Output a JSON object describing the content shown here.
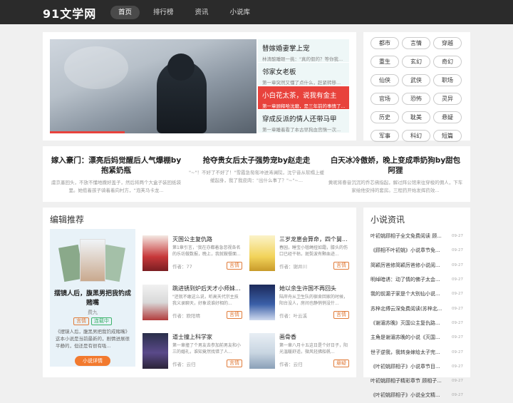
{
  "header": {
    "logo": "91文学网",
    "nav": [
      "首页",
      "排行榜",
      "资讯",
      "小说库"
    ]
  },
  "banner": {
    "items": [
      {
        "title": "替嫁婚妻掌上宠",
        "desc": "林清酿睡眼一挑：\"真的假的？等你我..."
      },
      {
        "title": "邻家女老板",
        "desc": "第一章突然又懂了点什么，赶紧转移..."
      },
      {
        "title": "小白花太茶，说我有金主",
        "desc": "第一章顾释哈沈磨，是三年前的事情了..."
      },
      {
        "title": "穿成反派的情人还带马甲",
        "desc": "第一章睡着看了本古早狗血宫惰一次..."
      }
    ]
  },
  "categories": [
    "都市",
    "言情",
    "穿越",
    "重生",
    "玄幻",
    "奇幻",
    "仙侠",
    "武侠",
    "职场",
    "官场",
    "恐怖",
    "灵异",
    "历史",
    "耽美",
    "悬疑",
    "军事",
    "科幻",
    "短篇"
  ],
  "featured": [
    {
      "title": "嫁入豪门：漂亮后妈觉醒后人气爆棚by抱紧奶瓶",
      "desc": "虞京墨回头，不放不懂地撒好盖子，然后将两个大盒子装回纸袋里。她揽着孩子骑着着向村方，“泡芙马卡龙..."
    },
    {
      "title": "抢夺贵女后太子强势宠by赵走走",
      "desc": "\"~\"！不好了不好了！\"雪霞急匆匆冲进浠澜院，沈宁音从软榻上缓缓起身，我了我皮肉：\"出什么事了？\"~\"~..."
    },
    {
      "title": "白天冰冷傲娇，晚上变成乖奶狗by甜包阿狸",
      "desc": "黄昵将眷音沉沉的乔芯佛指起，解过阵公馆来往穿梭的佣人，下车家绘他安排的套房。三程药开始发挥药效..."
    }
  ],
  "editor": {
    "title": "编辑推荐",
    "main": {
      "title": "摆镜人后，腹黑男把我钓成赌嘴",
      "author": "费九",
      "tags": [
        "言情",
        "连载中"
      ],
      "desc": "《摆镜人后，腹黑男把我钓成赌嘴》这本小说是当前最新的，剧情进展很平静的，但还是有很有吸...",
      "button": "小说详情"
    },
    "books": [
      {
        "title": "灭国公主复仇路",
        "desc": "第1章引言，'我在亦都着急忽视各名的乐坊做数报，晚上，我就鞍餐面...",
        "author": "作者：77",
        "tag": "言情"
      },
      {
        "title": "三岁龙崽会算命，四个舅...",
        "desc": "春园，睡宝小毯绳扭如霜，膝头的伤口已经干枯，斑鬓波有颗血迹...",
        "author": "作者：谢井川",
        "tag": "言情"
      },
      {
        "title": "跳进锈到炉后天才小师妹...",
        "desc": "\"还就不敢这么说，听高天代宗主技我义录聊天，好象说谁好相的...",
        "author": "作者：欧阳晴",
        "tag": "言情"
      },
      {
        "title": "她以余生许国不再回头",
        "desc": "陆岸舟从卫生队的宿舍回家的时候，阳台没人，房间也静悄悄没什...",
        "author": "作者：叶云溪",
        "tag": "言情"
      },
      {
        "title": "道士撞上科学家",
        "desc": "第一章撞了个男友去参加前男友和小三的婚礼，谁知竟然找错了人...",
        "author": "作者：云归",
        "tag": "言情"
      },
      {
        "title": "画骨香",
        "desc": "第一章八月十五这日是个好日子，阳光温暖舒适，微风轻拂船帆...",
        "author": "作者：云归",
        "tag": "悬疑"
      }
    ]
  },
  "news": {
    "title": "小说资讯",
    "items": [
      {
        "title": "叶初姚顾相子全文免费阅读 顾...",
        "date": "09-27"
      },
      {
        "title": "《顾相不叶初姚》小说章节免...",
        "date": "09-27"
      },
      {
        "title": "简颖厉爸修简颖厉爸修小说阅...",
        "date": "09-27"
      },
      {
        "title": "明绰暗诱：动了情的佛子太会...",
        "date": "09-27"
      },
      {
        "title": "我的前漏子家是个大别仙小说...",
        "date": "09-27"
      },
      {
        "title": "苏梓北傅云深免费阅读(苏梓北...",
        "date": "09-27"
      },
      {
        "title": "《谢湄苏晚》灭国公主复仇路...",
        "date": "09-27"
      },
      {
        "title": "主角是谢湄苏晚的小说《灭国...",
        "date": "09-27"
      },
      {
        "title": "世子逆我，我转身嫁给太子完...",
        "date": "09-27"
      },
      {
        "title": "《叶初姚顾相子》小说章节目...",
        "date": "09-27"
      },
      {
        "title": "叶初姚顾相子精彩章节 顾相子...",
        "date": "09-27"
      },
      {
        "title": "《叶初姚顾相子》小说全文精...",
        "date": "09-27"
      }
    ]
  },
  "colors": {
    "accent": "#e8423c",
    "topbar": "#2b2b2b",
    "button": "#f27a2f"
  }
}
